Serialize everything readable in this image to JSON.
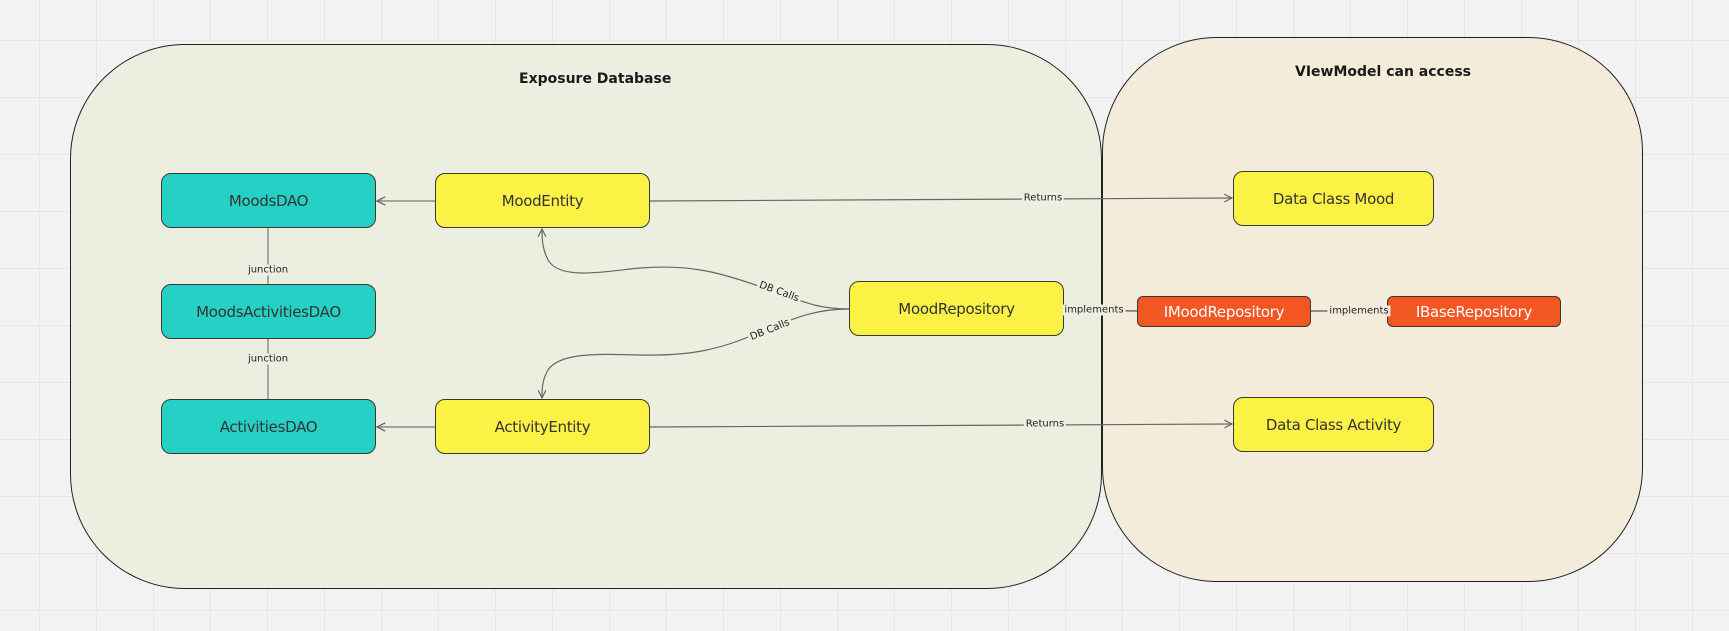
{
  "containers": {
    "left": {
      "title": "Exposure Database",
      "fill": "#EDEFE0"
    },
    "right": {
      "title": "VIewModel can access",
      "fill": "#F2ECDC"
    }
  },
  "colors": {
    "dao": "#25D1C5",
    "entity": "#FBF245",
    "interface": "#F25623",
    "background": "#F2F2F2"
  },
  "nodes": {
    "moods_dao": "MoodsDAO",
    "moods_activities_dao": "MoodsActivitiesDAO",
    "activities_dao": "ActivitiesDAO",
    "mood_entity": "MoodEntity",
    "activity_entity": "ActivityEntity",
    "mood_repository": "MoodRepository",
    "data_class_mood": "Data Class Mood",
    "data_class_activity": "Data Class Activity",
    "imood_repository": "IMoodRepository",
    "ibase_repository": "IBaseRepository"
  },
  "edges": {
    "junction_1": "junction",
    "junction_2": "junction",
    "db_calls_1": "DB Calls",
    "db_calls_2": "DB Calls",
    "returns_mood": "Returns",
    "returns_activity": "Returns",
    "implements_1": "implements",
    "implements_2": "implements"
  }
}
